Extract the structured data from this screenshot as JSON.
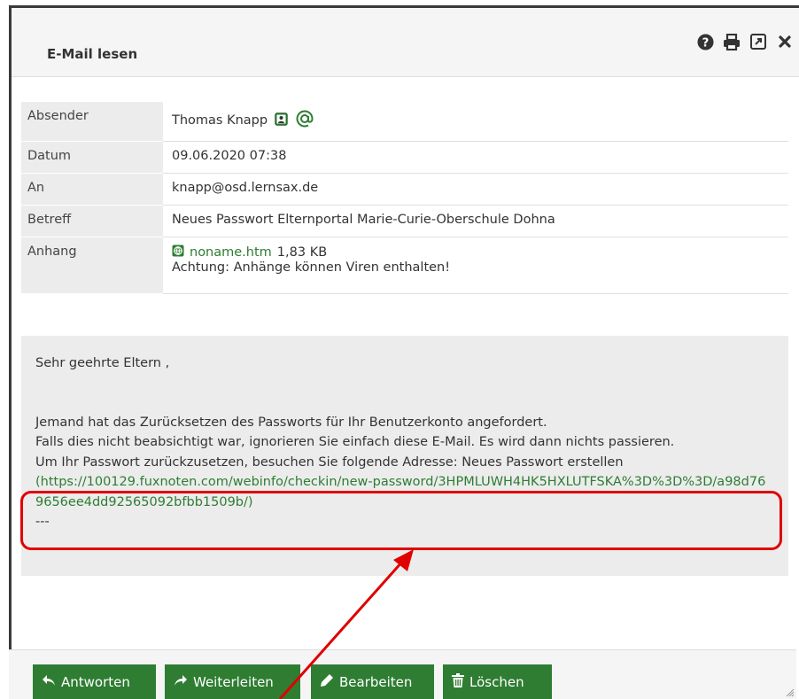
{
  "window": {
    "title": "E-Mail lesen"
  },
  "toolbar": {
    "help_icon": "question-circle-icon",
    "print_icon": "printer-icon",
    "external_icon": "open-external-icon",
    "close_icon": "close-icon"
  },
  "meta": {
    "sender_label": "Absender",
    "sender_value": "Thomas Knapp",
    "date_label": "Datum",
    "date_value": "09.06.2020 07:38",
    "to_label": "An",
    "to_value": "knapp@osd.lernsax.de",
    "subject_label": "Betreff",
    "subject_value": "Neues Passwort Elternportal Marie-Curie-Oberschule Dohna",
    "attachment_label": "Anhang",
    "attachment_name": "noname.htm",
    "attachment_size": "1,83 KB",
    "attachment_warning": "Achtung: Anhänge können Viren enthalten!"
  },
  "message": {
    "greeting": "Sehr geehrte Eltern ,",
    "line1": "Jemand hat das Zurücksetzen des Passworts für Ihr Benutzerkonto angefordert.",
    "line2": "Falls dies nicht beabsichtigt war, ignorieren Sie einfach diese E-Mail. Es wird dann nichts passieren.",
    "line3": "Um Ihr Passwort zurückzusetzen, besuchen Sie folgende Adresse: Neues Passwort erstellen",
    "url": "(https://100129.fuxnoten.com/webinfo/checkin/new-password/3HPMLUWH4HK5HXLUTFSKA%3D%3D%3D/a98d769656ee4dd92565092bfbb1509b/)",
    "signature": "---"
  },
  "footer": {
    "reply_label": "Antworten",
    "forward_label": "Weiterleiten",
    "edit_label": "Bearbeiten",
    "delete_label": "Löschen"
  },
  "colors": {
    "accent": "#2e7d32",
    "annotation": "#e00000"
  }
}
